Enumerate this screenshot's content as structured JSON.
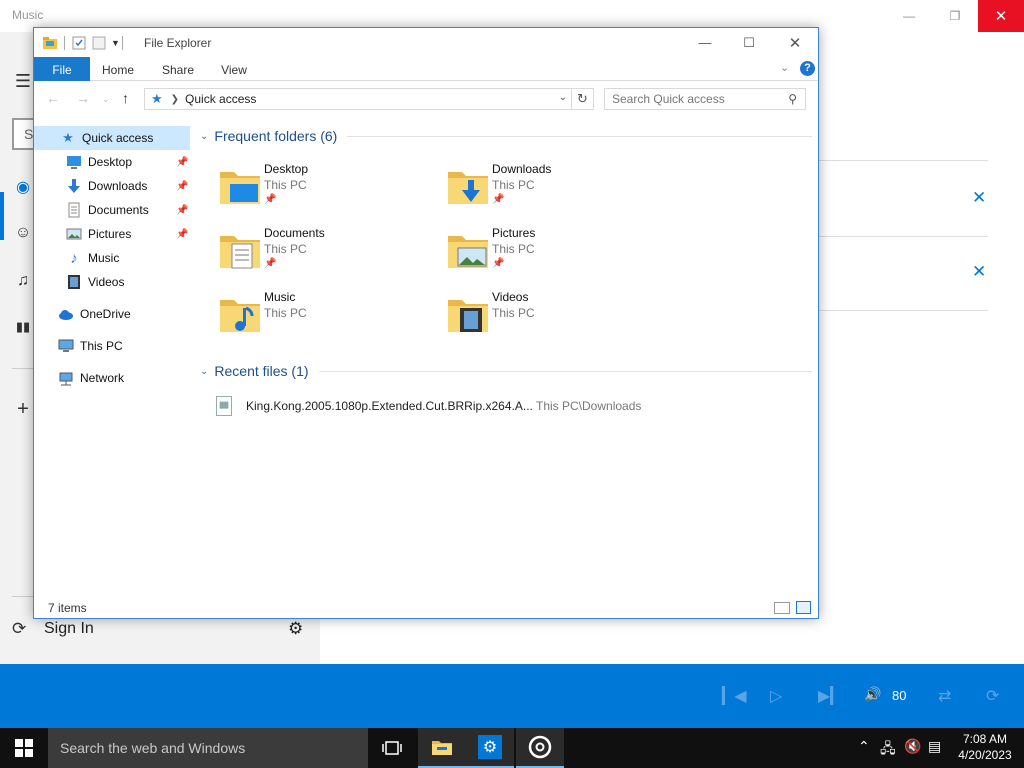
{
  "music_app": {
    "title": "Music",
    "search_partial": "S",
    "signin_label": "Sign In",
    "volume": "80"
  },
  "explorer": {
    "title": "File Explorer",
    "ribbon_tabs": [
      "File",
      "Home",
      "Share",
      "View"
    ],
    "address_path": "Quick access",
    "search_placeholder": "Search Quick access",
    "nav_items": [
      {
        "label": "Quick access",
        "icon": "quick-access-icon"
      },
      {
        "label": "Desktop",
        "icon": "desktop-icon",
        "pinned": true
      },
      {
        "label": "Downloads",
        "icon": "downloads-icon",
        "pinned": true
      },
      {
        "label": "Documents",
        "icon": "documents-icon",
        "pinned": true
      },
      {
        "label": "Pictures",
        "icon": "pictures-icon",
        "pinned": true
      },
      {
        "label": "Music",
        "icon": "music-icon"
      },
      {
        "label": "Videos",
        "icon": "videos-icon"
      },
      {
        "label": "OneDrive",
        "icon": "onedrive-icon"
      },
      {
        "label": "This PC",
        "icon": "this-pc-icon"
      },
      {
        "label": "Network",
        "icon": "network-icon"
      }
    ],
    "frequent_title": "Frequent folders (6)",
    "frequent_folders": [
      {
        "name": "Desktop",
        "location": "This PC",
        "pinned": true
      },
      {
        "name": "Downloads",
        "location": "This PC",
        "pinned": true
      },
      {
        "name": "Documents",
        "location": "This PC",
        "pinned": true
      },
      {
        "name": "Pictures",
        "location": "This PC",
        "pinned": true
      },
      {
        "name": "Music",
        "location": "This PC",
        "pinned": false
      },
      {
        "name": "Videos",
        "location": "This PC",
        "pinned": false
      }
    ],
    "recent_title": "Recent files (1)",
    "recent_files": [
      {
        "name": "King.Kong.2005.1080p.Extended.Cut.BRRip.x264.A...",
        "location": "This PC\\Downloads"
      }
    ],
    "status_count": "7 items"
  },
  "taskbar": {
    "search_placeholder": "Search the web and Windows",
    "time": "7:08 AM",
    "date": "4/20/2023"
  },
  "colors": {
    "accent": "#0078d7",
    "close_red": "#e81123",
    "selection": "#cce8ff",
    "taskbar": "#101010",
    "folder_yellow": "#f8d775"
  }
}
